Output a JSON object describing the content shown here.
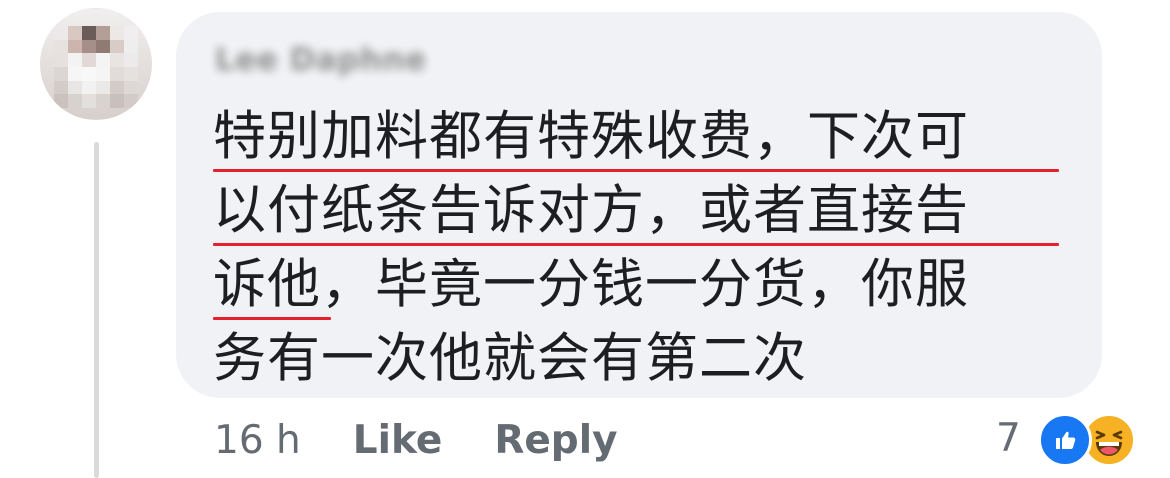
{
  "post": {
    "author_name": "Lee Daphne",
    "comment_lines": [
      "特别加料都有特殊收费，下次可",
      "以付纸条告诉对方，或者直接告",
      "诉他，毕竟一分钱一分货，你服",
      "务有一次他就会有第二次"
    ],
    "underline_color": "#e5212f",
    "bubble_color": "#f0f2f5",
    "text_color": "#1c1e21"
  },
  "actions": {
    "timestamp": "16 h",
    "like_label": "Like",
    "reply_label": "Reply"
  },
  "reactions": {
    "count": "7",
    "icons": [
      "like-reaction-icon",
      "haha-reaction-icon"
    ],
    "like_color": "#1877f2",
    "haha_color": "#f7b125"
  }
}
